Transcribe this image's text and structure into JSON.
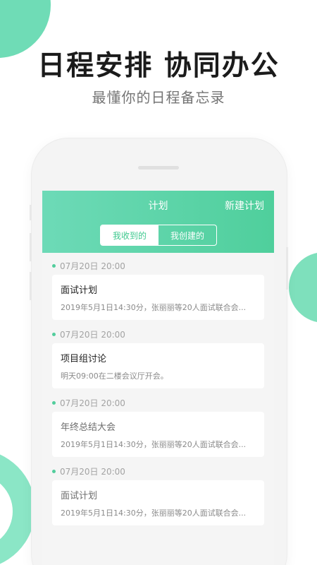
{
  "promo": {
    "headline": "日程安排  协同办公",
    "subline": "最懂你的日程备忘录"
  },
  "app": {
    "header": {
      "title": "计划",
      "action_label": "新建计划"
    },
    "tabs": [
      {
        "label": "我收到的",
        "active": true
      },
      {
        "label": "我创建的",
        "active": false
      }
    ],
    "plans": [
      {
        "time": "07月20日  20:00",
        "title": "面试计划",
        "description": "2019年5月1日14:30分，张丽丽等20人面试联合会..."
      },
      {
        "time": "07月20日  20:00",
        "title": "项目组讨论",
        "description": "明天09:00在二楼会议厅开会。"
      },
      {
        "time": "07月20日  20:00",
        "title": "年终总结大会",
        "description": "2019年5月1日14:30分，张丽丽等20人面试联合会..."
      },
      {
        "time": "07月20日  20:00",
        "title": "面试计划",
        "description": "2019年5月1日14:30分，张丽丽等20人面试联合会..."
      }
    ]
  },
  "colors": {
    "accent": "#4fcf9c",
    "accent_light": "#6ddab7",
    "headline": "#1b1b1b",
    "subline": "#747474"
  }
}
